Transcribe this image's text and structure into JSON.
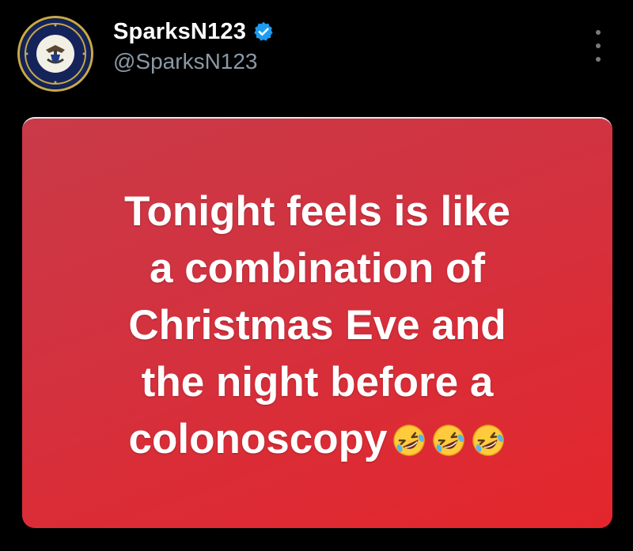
{
  "tweet": {
    "author": {
      "display_name": "SparksN123",
      "handle": "@SparksN123",
      "verified": true,
      "avatar": "navy-seal-logo"
    },
    "menu_icon": "more-options-icon",
    "image_card": {
      "background_color": "#d9303c",
      "lines": [
        "Tonight feels is like",
        "a combination of",
        "Christmas Eve and",
        "the night before a",
        "colonoscopy"
      ],
      "trailing_emoji": "rolling-on-floor-laughing",
      "emoji_count": 3
    }
  },
  "colors": {
    "background": "#000000",
    "handle": "#8b98a5",
    "verified": "#1d9bf0",
    "card": "#d9303c"
  }
}
